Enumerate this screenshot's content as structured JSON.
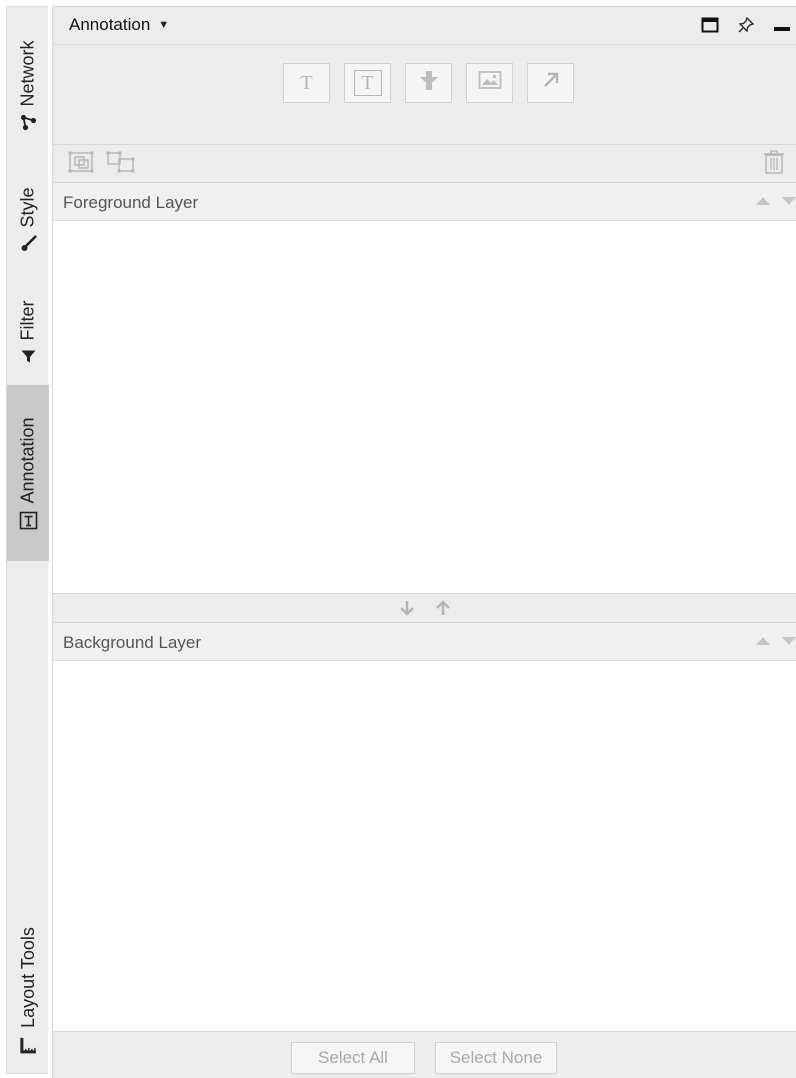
{
  "side_tabs": {
    "network": {
      "label": "Network",
      "icon": "network-icon"
    },
    "style": {
      "label": "Style",
      "icon": "brush-icon"
    },
    "filter": {
      "label": "Filter",
      "icon": "filter-icon"
    },
    "annotation": {
      "label": "Annotation",
      "icon": "text-box-icon",
      "selected": true
    },
    "layout_tools": {
      "label": "Layout Tools",
      "icon": "ruler-icon"
    }
  },
  "panel": {
    "title": "Annotation",
    "window_icons": [
      "maximize-icon",
      "pin-icon",
      "minimize-icon"
    ]
  },
  "tools": [
    {
      "name": "text",
      "glyph": "T"
    },
    {
      "name": "bounded-text",
      "glyph": "T"
    },
    {
      "name": "shape"
    },
    {
      "name": "image"
    },
    {
      "name": "arrow"
    }
  ],
  "actions": {
    "group": "group-icon",
    "ungroup": "ungroup-icon",
    "delete": "trash-icon"
  },
  "foreground": {
    "label": "Foreground Layer"
  },
  "background": {
    "label": "Background Layer"
  },
  "buttons": {
    "select_all": "Select All",
    "select_none": "Select None"
  },
  "colors": {
    "bar_bg": "#ececec",
    "selected_tab": "#c9c9c9",
    "disabled": "#b4b4b4"
  }
}
